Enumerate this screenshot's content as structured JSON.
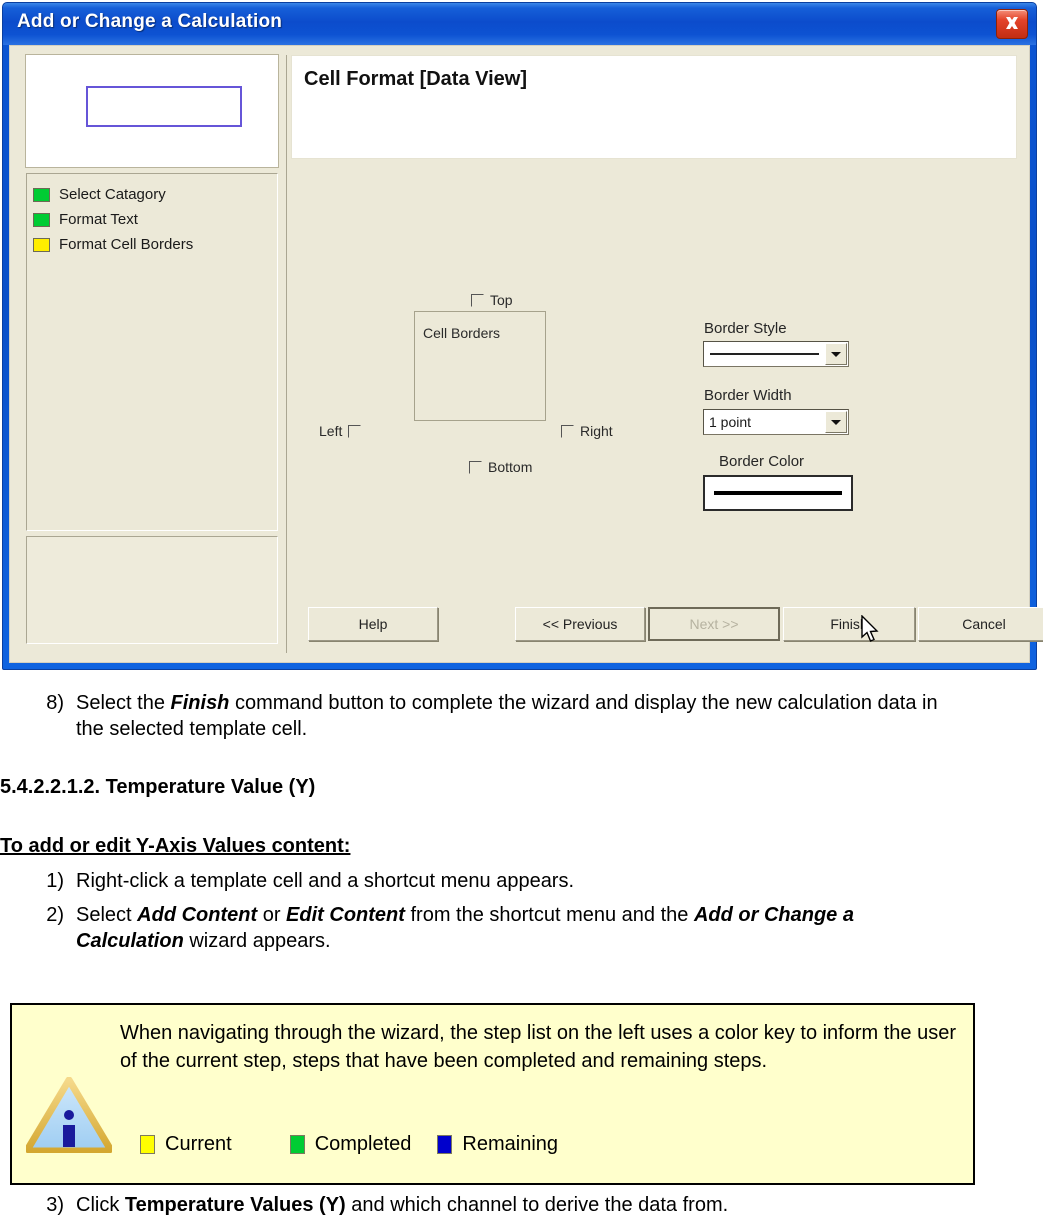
{
  "dialog": {
    "title": "Add or Change a Calculation",
    "close_icon": "close-icon",
    "sidebar": {
      "preview_label": "",
      "steps": [
        {
          "label": "Select Catagory",
          "color": "#00CC33",
          "state": "Completed"
        },
        {
          "label": "Format Text",
          "color": "#00CC33",
          "state": "Completed"
        },
        {
          "label": "Format Cell Borders",
          "color": "#FFEE00",
          "state": "Current"
        }
      ]
    },
    "main": {
      "header_title": "Cell Format [Data View]",
      "cell_borders": {
        "legend": "Cell Borders",
        "checkboxes": [
          {
            "label": "Top",
            "checked": false
          },
          {
            "label": "Left",
            "checked": false
          },
          {
            "label": "Right",
            "checked": false
          },
          {
            "label": "Bottom",
            "checked": false
          }
        ]
      },
      "border_style": {
        "label": "Border Style",
        "value": ""
      },
      "border_width": {
        "label": "Border Width",
        "value": "1 point"
      },
      "border_color": {
        "label": "Border Color",
        "value": "#000000"
      }
    },
    "footer": {
      "help": "Help",
      "previous": "<< Previous",
      "next": "Next >>",
      "finish": "Finish",
      "cancel": "Cancel"
    }
  },
  "document": {
    "step8": {
      "num": "8)",
      "text_1": "Select the ",
      "bold_1": "Finish",
      "text_2": " command button to complete the wizard and display the new calculation data in the selected template cell."
    },
    "section_heading": "5.4.2.2.1.2. Temperature Value (Y)",
    "subheading": "To add or edit Y-Axis Values content:",
    "step1": {
      "num": "1)",
      "text": "Right-click a template cell and a shortcut menu appears."
    },
    "step2": {
      "num": "2)",
      "text_1": "Select ",
      "bold_1": "Add Content",
      "text_2": " or ",
      "bold_2": "Edit Content",
      "text_3": " from the shortcut menu and the ",
      "bold_3": "Add or Change a Calculation",
      "text_4": " wizard appears."
    },
    "step3": {
      "num": "3)",
      "text_1": "Click ",
      "bold_1": "Temperature Values (Y)",
      "text_2": " and which channel to derive the data from."
    },
    "note": {
      "icon": "info-triangle-icon",
      "body": "When navigating through the wizard, the step list on the left uses a color key to inform the user of the current step, steps that have been completed and remaining steps.",
      "key": [
        {
          "label": "Current",
          "color": "#FFFF00"
        },
        {
          "label": "Completed",
          "color": "#00CC33"
        },
        {
          "label": "Remaining",
          "color": "#0000CC"
        }
      ]
    }
  }
}
